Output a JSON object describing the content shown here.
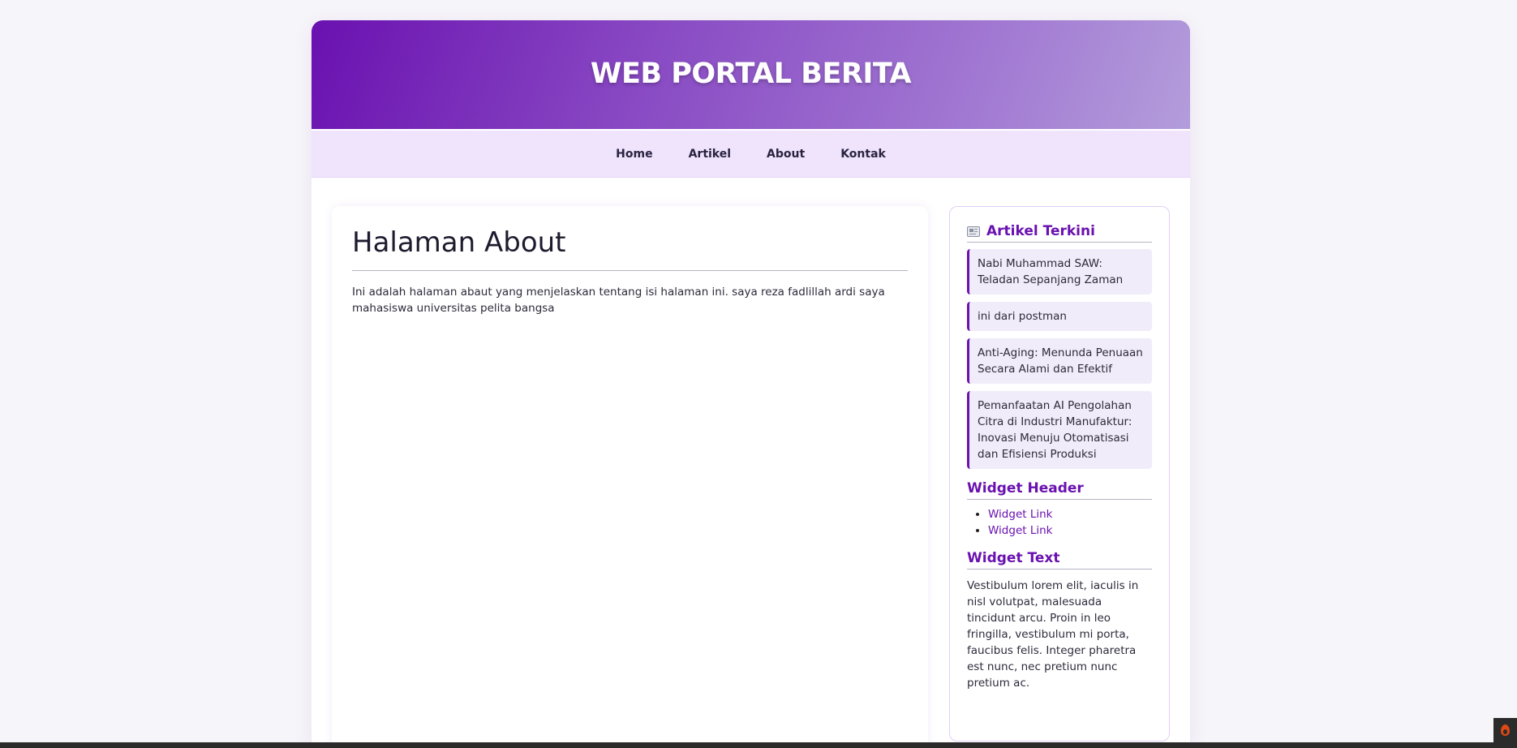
{
  "header": {
    "site_title": "WEB PORTAL BERITA"
  },
  "nav": {
    "items": [
      {
        "label": "Home"
      },
      {
        "label": "Artikel"
      },
      {
        "label": "About"
      },
      {
        "label": "Kontak"
      }
    ]
  },
  "main": {
    "page_title": "Halaman About",
    "body_text": "Ini adalah halaman abaut yang menjelaskan tentang isi halaman ini. saya reza fadlillah ardi saya mahasiswa universitas pelita bangsa"
  },
  "sidebar": {
    "recent_articles": {
      "icon": "newspaper-icon",
      "title": "Artikel Terkini",
      "items": [
        {
          "title": "Nabi Muhammad SAW: Teladan Sepanjang Zaman"
        },
        {
          "title": "ini dari postman"
        },
        {
          "title": "Anti-Aging: Menunda Penuaan Secara Alami dan Efektif"
        },
        {
          "title": "Pemanfaatan AI Pengolahan Citra di Industri Manufaktur: Inovasi Menuju Otomatisasi dan Efisiensi Produksi"
        }
      ]
    },
    "widget_links": {
      "title": "Widget Header",
      "links": [
        {
          "label": "Widget Link"
        },
        {
          "label": "Widget Link"
        }
      ]
    },
    "widget_text": {
      "title": "Widget Text",
      "text": "Vestibulum lorem elit, iaculis in nisl volutpat, malesuada tincidunt arcu. Proin in leo fringilla, vestibulum mi porta, faucibus felis. Integer pharetra est nunc, nec pretium nunc pretium ac."
    }
  },
  "colors": {
    "accent": "#6a11b0",
    "nav_bg": "#efe4fc",
    "page_bg": "#f6f5f9"
  },
  "debug_toolbar": {
    "icon": "codeigniter-flame-icon"
  }
}
